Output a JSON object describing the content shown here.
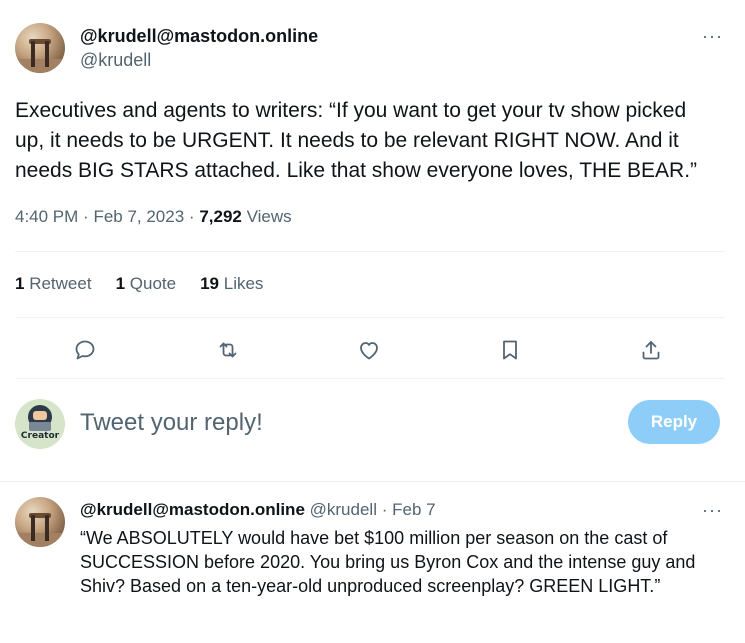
{
  "tweet": {
    "display_name": "@krudell@mastodon.online",
    "handle": "@krudell",
    "more": "···",
    "text": "Executives and agents to writers: “If you want to get your tv show picked up, it needs to be URGENT. It needs to be relevant RIGHT NOW. And it needs BIG STARS attached. Like that show everyone loves, THE BEAR.”",
    "time": "4:40 PM",
    "date": "Feb 7, 2023",
    "views_count": "7,292",
    "views_label": "Views"
  },
  "stats": {
    "retweets_count": "1",
    "retweets_label": "Retweet",
    "quotes_count": "1",
    "quotes_label": "Quote",
    "likes_count": "19",
    "likes_label": "Likes"
  },
  "actions": [
    "reply-icon",
    "retweet-icon",
    "like-icon",
    "bookmark-icon",
    "share-icon"
  ],
  "compose": {
    "avatar_label": "Creator",
    "placeholder": "Tweet your reply!",
    "button_label": "Reply"
  },
  "reply": {
    "display_name": "@krudell@mastodon.online",
    "handle": "@krudell",
    "dot": "·",
    "date": "Feb 7",
    "more": "···",
    "text": "“We ABSOLUTELY would have bet $100 million per season on the cast of SUCCESSION before 2020. You bring us Byron Cox and the intense guy and Shiv? Based on a ten-year-old unproduced screenplay? GREEN LIGHT.”"
  },
  "colors": {
    "text_primary": "#0f1419",
    "text_secondary": "#536471",
    "reply_button": "#8ecdf8",
    "divider": "#eff3f4"
  }
}
